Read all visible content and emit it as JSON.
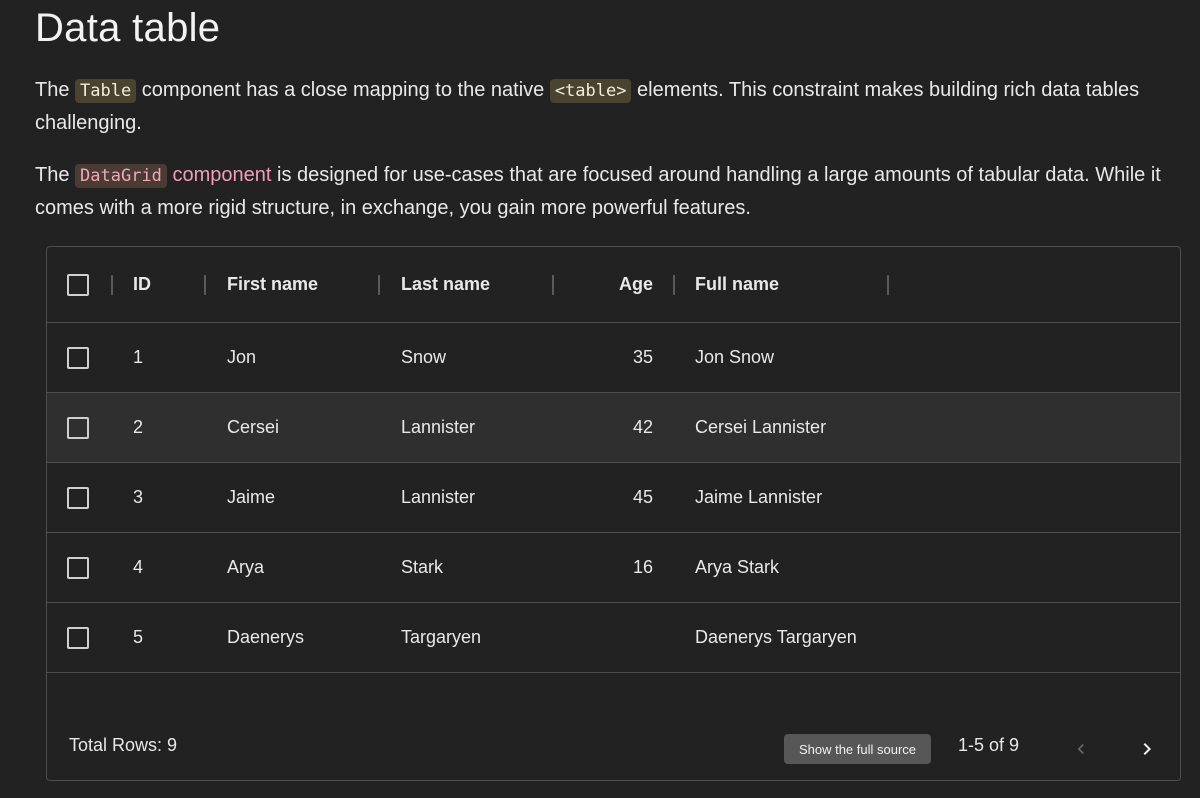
{
  "page": {
    "title": "Data table",
    "p1": {
      "t1": "The ",
      "code1": "Table",
      "t2": " component has a close mapping to the native ",
      "code2": "<table>",
      "t3": " elements. This constraint makes building rich data tables challenging."
    },
    "p2": {
      "t1": "The ",
      "code1": "DataGrid",
      "link": " component",
      "t2": " is designed for use-cases that are focused around handling a large amounts of tabular data. While it comes with a more rigid structure, in exchange, you gain more powerful features."
    }
  },
  "grid": {
    "columns": {
      "id": "ID",
      "first": "First name",
      "last": "Last name",
      "age": "Age",
      "full": "Full name"
    },
    "rows": [
      {
        "id": "1",
        "first": "Jon",
        "last": "Snow",
        "age": "35",
        "full": "Jon Snow"
      },
      {
        "id": "2",
        "first": "Cersei",
        "last": "Lannister",
        "age": "42",
        "full": "Cersei Lannister"
      },
      {
        "id": "3",
        "first": "Jaime",
        "last": "Lannister",
        "age": "45",
        "full": "Jaime Lannister"
      },
      {
        "id": "4",
        "first": "Arya",
        "last": "Stark",
        "age": "16",
        "full": "Arya Stark"
      },
      {
        "id": "5",
        "first": "Daenerys",
        "last": "Targaryen",
        "age": "",
        "full": "Daenerys Targaryen"
      }
    ],
    "hovered_row": 1,
    "footer": {
      "total": "Total Rows: 9",
      "source_button": "Show the full source",
      "pagination": "1-5 of 9",
      "prev_icon": "chevron-left-icon",
      "next_icon": "chevron-right-icon"
    }
  },
  "colors": {
    "background": "#222222",
    "border": "#4e4e4e",
    "link": "#f19cba"
  }
}
